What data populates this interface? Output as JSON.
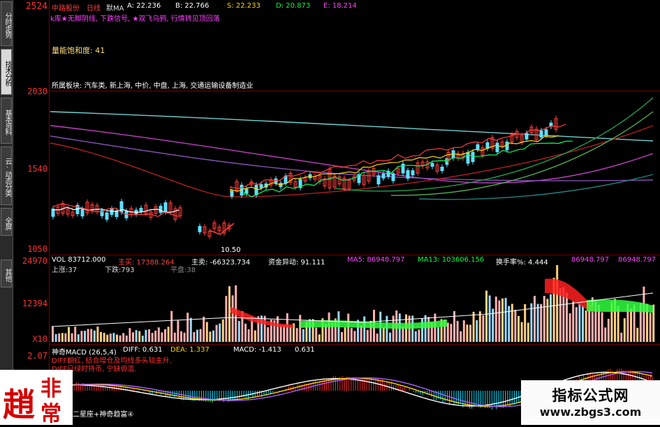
{
  "sidebar": {
    "tabs": [
      {
        "label": "分时走势",
        "active": false
      },
      {
        "label": "技术分析",
        "active": true
      },
      {
        "label": "基本资料",
        "active": false
      },
      {
        "label": "云·动态分类",
        "active": false
      },
      {
        "label": "全屏",
        "active": false
      },
      {
        "label": "其他",
        "active": false
      }
    ]
  },
  "price_panel": {
    "axis": {
      "top": "2524",
      "mid1": "2030",
      "mid2": "1540",
      "bottom": "1050"
    },
    "header": {
      "stock": "中路股份",
      "period": "日线",
      "mode": "默MA",
      "a": "A: 22.236",
      "b": "B: 22.766",
      "s": "S: 22.233",
      "d": "D: 20.873",
      "e": "E: 18.214"
    },
    "signals": "k库★无脚阴线, 下跌信号, ★双飞乌鸦, 行情转见顶回落",
    "saturation": "量能饱和度: 41",
    "sector": "所属板块: 汽车类, 新上海, 中价, 中盘, 上海, 交通运输设备制造业",
    "low_marker": "10.50"
  },
  "volume_panel": {
    "axis": {
      "top": "24970",
      "mid": "12394",
      "bottom": "X10"
    },
    "header": {
      "vol": "VOL 83712.000",
      "main_buy": "主买: 17388.264",
      "main_sell": "主卖: -66323.734",
      "fund_flow": "资金异动: 91.111",
      "ma5": "MA5: 86948.797",
      "ma13": "MA13: 103606.156",
      "turnover": "换手率%: 4.444",
      "v1": "86948.797",
      "v2": "86948.797"
    },
    "sub": {
      "up": "上涨:37",
      "down": "下跌:793",
      "flat": "平盘:38"
    }
  },
  "macd_panel": {
    "axis": {
      "top": "2.07"
    },
    "header": {
      "name": "神奇MACD (26,5,4)",
      "diff": "DIFF: 0.631",
      "dea": "DEA: 1.337",
      "macd": "MACD: -1.413",
      "v": "0.631"
    },
    "line1": "DIFF翻红, 结合增仓及均线多头较主升.",
    "line2": "DIFF已绿时持币, 宁缺毋滥.",
    "footer": "二星座+神奇趋富④"
  },
  "logo": {
    "chars": [
      "趙",
      "非",
      "常"
    ]
  },
  "watermark": {
    "title": "指标公式网",
    "url": "www.zbgs3.com"
  },
  "colors": {
    "up": "#ff3b3b",
    "down": "#5ee0ff",
    "ma_white": "#ffffff",
    "ma_yellow": "#ffd700",
    "grid": "#7a0000"
  }
}
